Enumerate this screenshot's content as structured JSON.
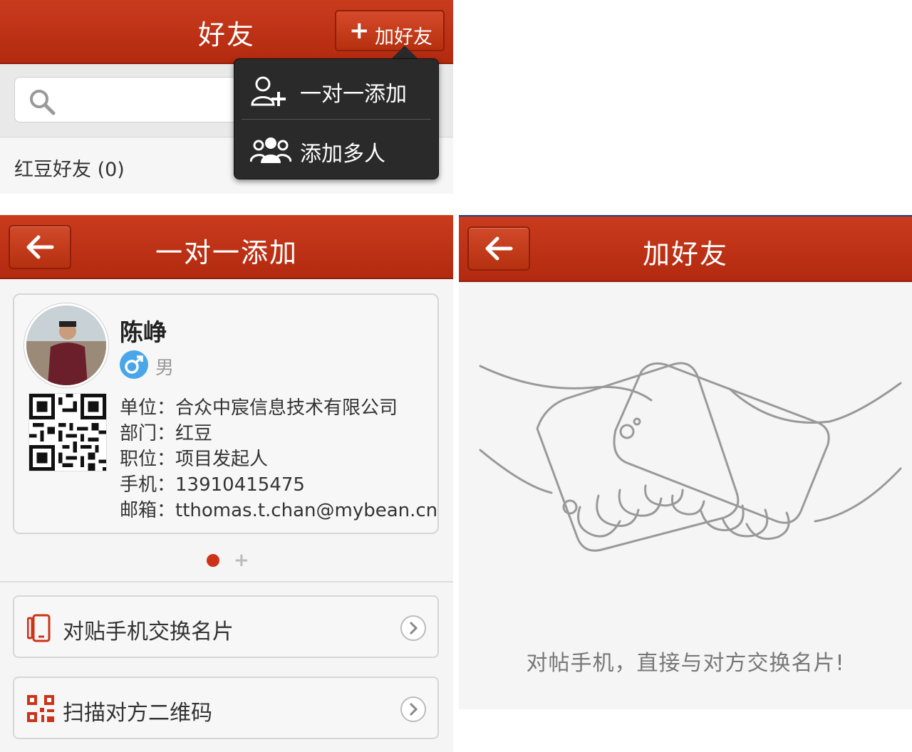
{
  "panel_friends": {
    "title": "好友",
    "add_button_label": "加好友",
    "search": {
      "placeholder": ""
    },
    "group_label": "红豆好友 (0)",
    "popup": {
      "items": [
        {
          "label": "一对一添加",
          "icon": "add-user-icon"
        },
        {
          "label": "添加多人",
          "icon": "group-icon"
        }
      ]
    }
  },
  "panel_one_to_one": {
    "title": "一对一添加",
    "card": {
      "name": "陈峥",
      "gender": "男",
      "gender_icon": "male-icon",
      "lines": [
        "单位：合众中宸信息技术有限公司",
        "部门：红豆",
        "职位：项目发起人",
        "手机：13910415475",
        "邮箱：tthomas.t.chan@mybean.cn"
      ]
    },
    "pager": {
      "active_index": 0,
      "extra": "+"
    },
    "options": [
      {
        "label": "对贴手机交换名片",
        "icon": "phone-icon"
      },
      {
        "label": "扫描对方二维码",
        "icon": "qr-code-icon"
      }
    ]
  },
  "panel_add_friend": {
    "title": "加好友",
    "caption": "对帖手机，直接与对方交换名片!"
  },
  "colors": {
    "header_red": "#c0341a",
    "accent": "#cc3318",
    "popup_bg": "#2a2a2a"
  }
}
